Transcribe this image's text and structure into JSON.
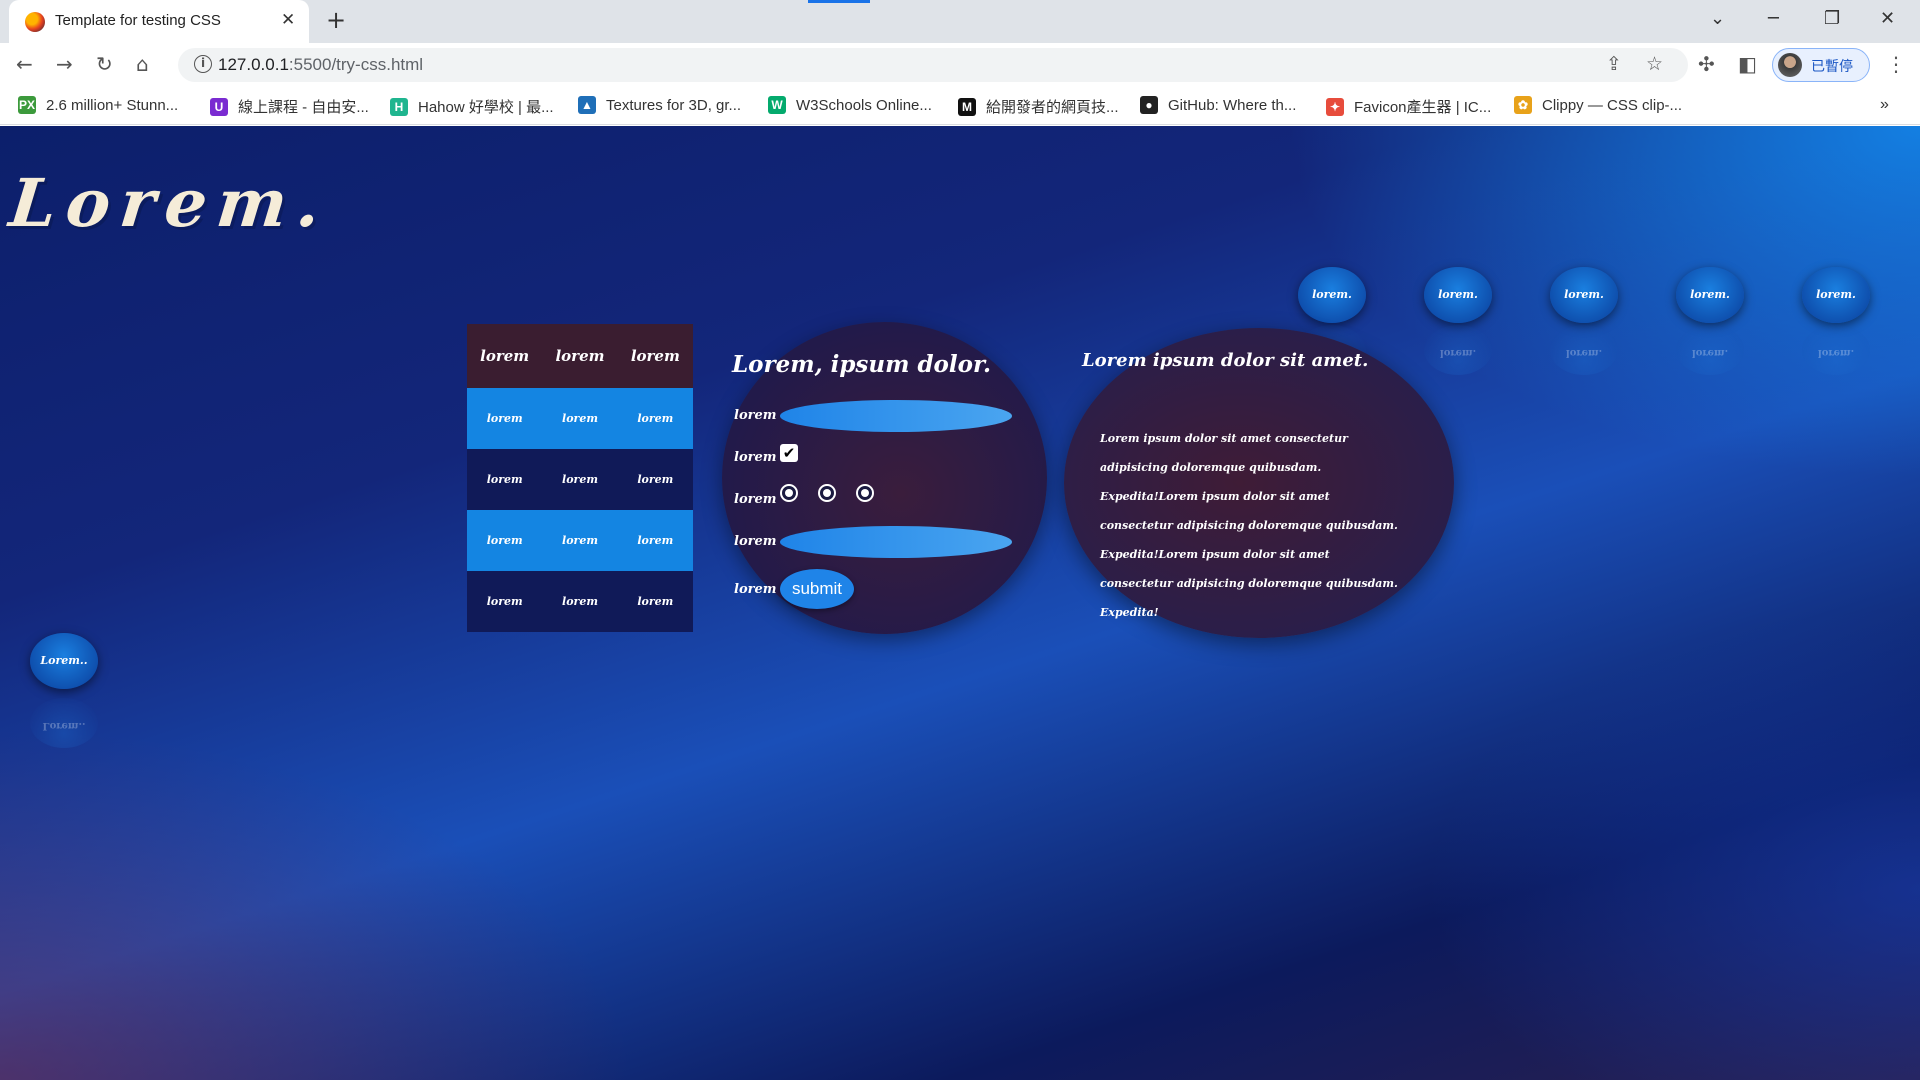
{
  "browser": {
    "tab_title": "Template for testing CSS",
    "tab_close": "✕",
    "new_tab": "+",
    "url_host": "127.0.0.1",
    "url_rest": ":5500/try-css.html",
    "profile_label": "已暫停",
    "bookmarks": [
      {
        "label": "2.6 million+ Stunn...",
        "icon": "px-icon",
        "color": "#3c9a3c",
        "glyph": "PX"
      },
      {
        "label": "線上課程 - 自由安...",
        "icon": "u-icon",
        "color": "#7a2bd1",
        "glyph": "U"
      },
      {
        "label": "Hahow 好學校 | 最...",
        "icon": "hahow-icon",
        "color": "#1fb58f",
        "glyph": "H"
      },
      {
        "label": "Textures for 3D, gr...",
        "icon": "cube-icon",
        "color": "#1f6fb8",
        "glyph": "▲"
      },
      {
        "label": "W3Schools Online...",
        "icon": "w3-icon",
        "color": "#04aa6d",
        "glyph": "W"
      },
      {
        "label": "給開發者的網頁技...",
        "icon": "mdn-icon",
        "color": "#111111",
        "glyph": "M"
      },
      {
        "label": "GitHub: Where th...",
        "icon": "github-icon",
        "color": "#222222",
        "glyph": "●"
      },
      {
        "label": "Favicon產生器 | IC...",
        "icon": "favicon-icon",
        "color": "#e74c3c",
        "glyph": "✦"
      },
      {
        "label": "Clippy — CSS clip-...",
        "icon": "clippy-icon",
        "color": "#e8a21a",
        "glyph": "✿"
      }
    ],
    "bookmarks_more": "»"
  },
  "page": {
    "hero": "Lorem.",
    "pills_top": [
      "lorem.",
      "lorem.",
      "lorem.",
      "lorem.",
      "lorem."
    ],
    "pill_side": "Lorem..",
    "table": {
      "header": [
        "lorem",
        "lorem",
        "lorem"
      ],
      "rows": [
        [
          "lorem",
          "lorem",
          "lorem"
        ],
        [
          "lorem",
          "lorem",
          "lorem"
        ],
        [
          "lorem",
          "lorem",
          "lorem"
        ],
        [
          "lorem",
          "lorem",
          "lorem"
        ]
      ]
    },
    "form": {
      "title": "Lorem, ipsum dolor.",
      "labels": [
        "lorem",
        "lorem",
        "lorem",
        "lorem",
        "lorem"
      ],
      "checkbox_checked": true,
      "radio_count": 3,
      "submit_label": "submit"
    },
    "text_card": {
      "title": "Lorem ipsum dolor sit amet.",
      "body": "Lorem ipsum dolor sit amet consectetur adipisicing doloremque quibusdam. Expedita!Lorem ipsum dolor sit amet consectetur adipisicing doloremque quibusdam. Expedita!Lorem ipsum dolor sit amet consectetur adipisicing doloremque quibusdam. Expedita!"
    }
  }
}
